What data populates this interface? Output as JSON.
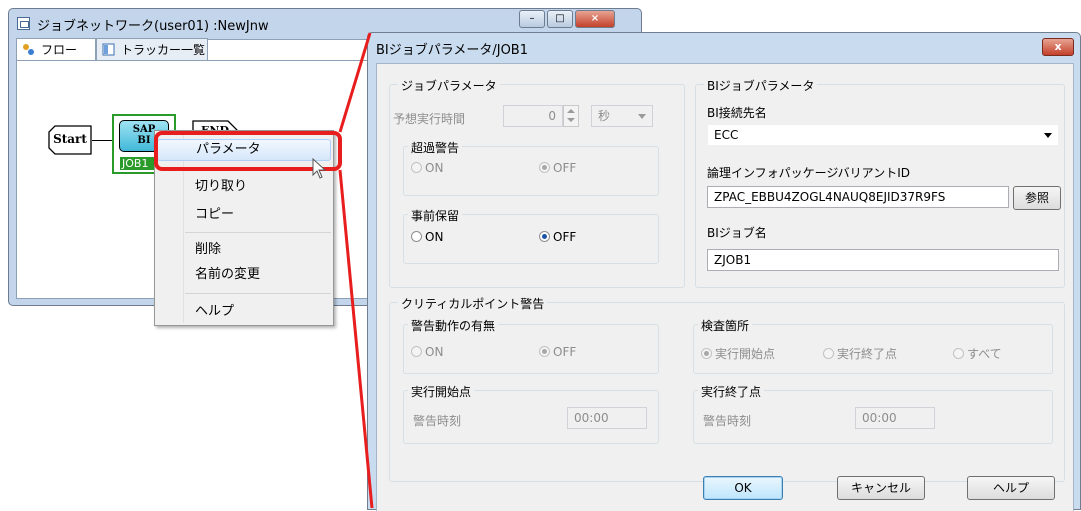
{
  "background_window": {
    "title": "ジョブネットワーク(user01) :NewJnw",
    "tabs": [
      {
        "label": "フロー",
        "icon": "flow-icon"
      },
      {
        "label": "トラッカー一覧",
        "icon": "tracker-list-icon"
      }
    ],
    "flow": {
      "start_label": "Start",
      "job_icon_text_1": "SAP",
      "job_icon_text_2": "BI",
      "job_label": "JOB1",
      "end_label": "END"
    }
  },
  "context_menu": {
    "items": [
      "パラメータ",
      "切り取り",
      "コピー",
      "削除",
      "名前の変更",
      "ヘルプ"
    ]
  },
  "dialog": {
    "title": "BIジョブパラメータ/JOB1",
    "close_label": "x",
    "job_params": {
      "group_title": "ジョブパラメータ",
      "expected_time_label": "予想実行時間",
      "expected_time_value": "0",
      "unit_value": "秒",
      "overtime_warning": {
        "title": "超過警告",
        "on_label": "ON",
        "off_label": "OFF",
        "selected": "OFF"
      },
      "pre_hold": {
        "title": "事前保留",
        "on_label": "ON",
        "off_label": "OFF",
        "selected": "OFF"
      }
    },
    "bi_params": {
      "group_title": "BIジョブパラメータ",
      "connection_label": "BI接続先名",
      "connection_value": "ECC",
      "variant_label": "論理インフォパッケージバリアントID",
      "variant_value": "ZPAC_EBBU4ZOGL4NAUQ8EJID37R9FS",
      "browse_label": "参照",
      "job_name_label": "BIジョブ名",
      "job_name_value": "ZJOB1"
    },
    "critical": {
      "group_title": "クリティカルポイント警告",
      "action": {
        "title": "警告動作の有無",
        "on_label": "ON",
        "off_label": "OFF",
        "selected": "OFF"
      },
      "check_point": {
        "title": "検査箇所",
        "options": [
          "実行開始点",
          "実行終了点",
          "すべて"
        ],
        "selected": "実行開始点"
      },
      "start_point": {
        "title": "実行開始点",
        "time_label": "警告時刻",
        "time_value": "00:00"
      },
      "end_point": {
        "title": "実行終了点",
        "time_label": "警告時刻",
        "time_value": "00:00"
      }
    },
    "buttons": {
      "ok": "OK",
      "cancel": "キャンセル",
      "help": "ヘルプ"
    }
  },
  "colors": {
    "highlight_red": "#e81d1d",
    "job_green": "#2a9a2a",
    "window_frame": "#c9dbee"
  }
}
